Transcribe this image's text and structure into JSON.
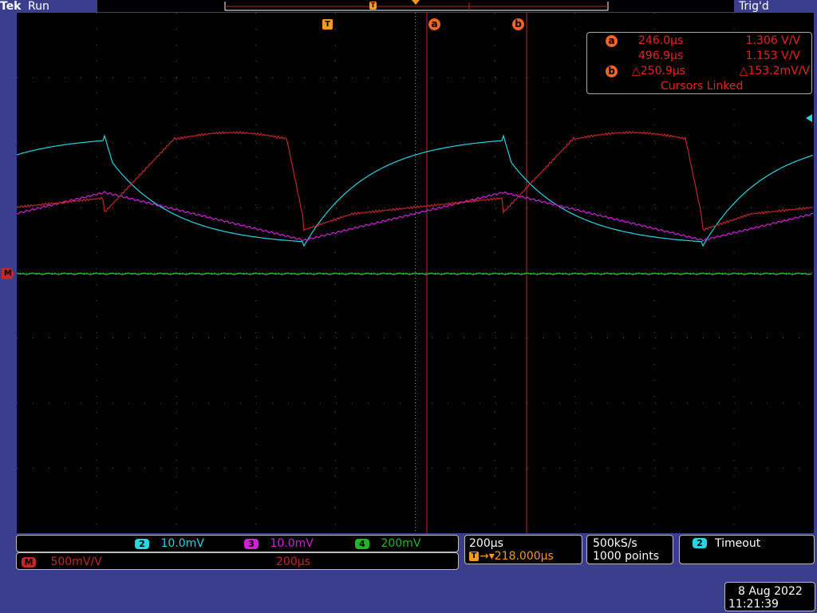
{
  "header": {
    "brand": "Tek",
    "acquisition_state": "Run",
    "trigger_status": "Trig'd"
  },
  "markers": {
    "trigger_marker": "T",
    "cursor_a": "a",
    "cursor_b": "b",
    "math_marker": "M"
  },
  "cursor_readout": {
    "a_time": "246.0µs",
    "a_value": "1.306 V/V",
    "b_time": "496.9µs",
    "b_value": "1.153 V/V",
    "delta_time": "△250.9µs",
    "delta_value": "△153.2mV/V",
    "linked_label": "Cursors Linked"
  },
  "channels": {
    "ch2": {
      "number": "2",
      "scale": "10.0mV",
      "color": "#26d6e0"
    },
    "ch3": {
      "number": "3",
      "scale": "10.0mV",
      "color": "#d020d8"
    },
    "ch4": {
      "number": "4",
      "scale": "200mV",
      "color": "#22b527"
    },
    "math": {
      "number": "M",
      "scale": "500mV/V",
      "time": "200µs",
      "color": "#c0282a"
    }
  },
  "horizontal": {
    "scale": "200µs",
    "trigger_icon": "T",
    "delay": "→▾218.000µs"
  },
  "acquisition": {
    "sample_rate": "500kS/s",
    "record_length": "1000 points"
  },
  "trigger": {
    "source": "2",
    "mode": "Timeout"
  },
  "datetime": {
    "date": "8 Aug 2022",
    "time": "11:21:39"
  },
  "colors": {
    "background": "#3a3e8c",
    "screen": "#000000",
    "cursor_line": "#c0282a",
    "cursor_badge": "#f26522",
    "trigger_marker": "#f59a1c",
    "readout_text": "#e8231f"
  }
}
